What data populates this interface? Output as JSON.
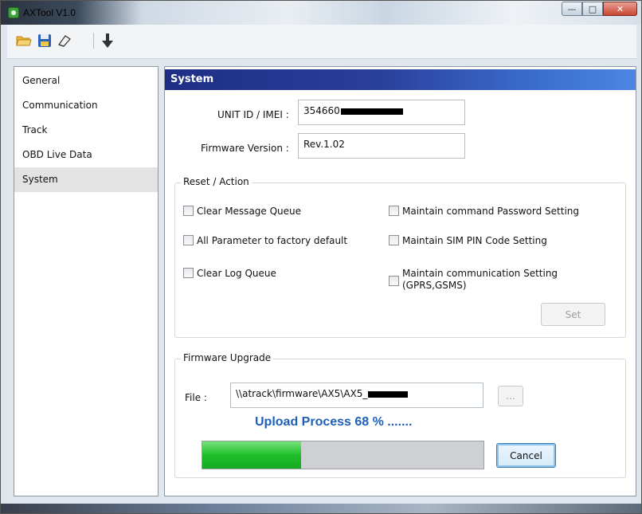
{
  "window": {
    "title": "AXTool V1.0"
  },
  "toolbar": {
    "icons": [
      "folder-open-icon",
      "save-icon",
      "eraser-icon",
      "download-arrow-icon"
    ]
  },
  "sidebar": {
    "items": [
      {
        "label": "General"
      },
      {
        "label": "Communication"
      },
      {
        "label": "Track"
      },
      {
        "label": "OBD Live Data"
      },
      {
        "label": "System"
      }
    ],
    "selected": "System"
  },
  "system": {
    "header": "System",
    "unit_id_label": "UNIT ID / IMEI :",
    "unit_id_value": "354660",
    "firmware_version_label": "Firmware Version :",
    "firmware_version_value": "Rev.1.02"
  },
  "reset_action": {
    "title": "Reset / Action",
    "left_options": [
      "Clear Message Queue",
      "All Parameter to factory default",
      "Clear Log Queue"
    ],
    "right_options": [
      "Maintain command Password Setting",
      "Maintain SIM PIN Code Setting",
      "Maintain communication Setting",
      "(GPRS,GSMS)"
    ],
    "set_label": "Set"
  },
  "firmware_upgrade": {
    "title": "Firmware Upgrade",
    "file_label": "File :",
    "file_value": "\\\\atrack\\firmware\\AX5\\AX5_",
    "browse_label": "...",
    "upload_text": "Upload Process 68 % .......",
    "progress": 0.35,
    "cancel_label": "Cancel"
  },
  "colors": {
    "header_blue": "#2a3f9a",
    "progress_green": "#1fbf2b",
    "upload_text_blue": "#1f5fb8"
  }
}
